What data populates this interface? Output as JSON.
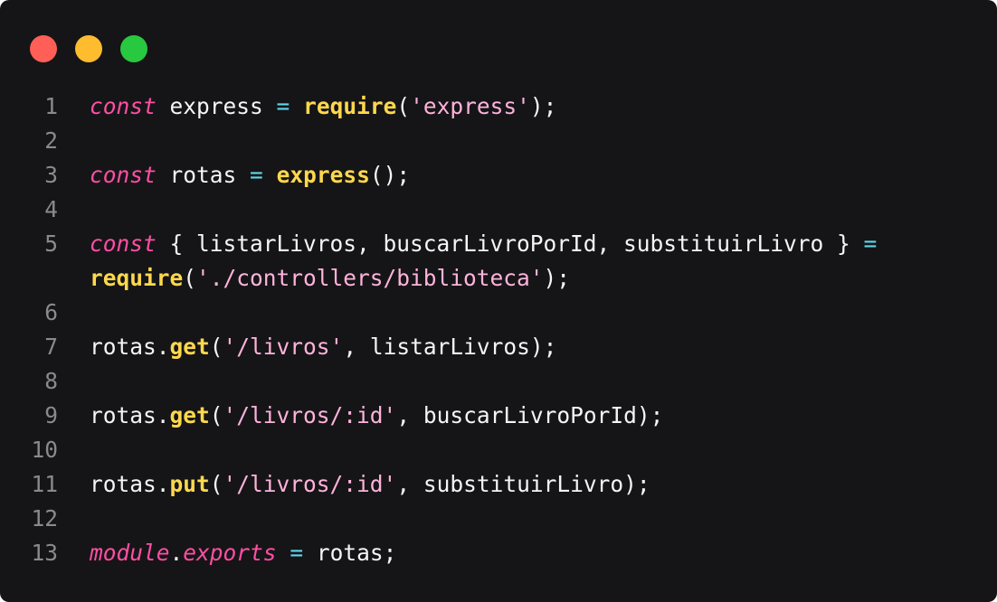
{
  "window": {
    "controls": [
      {
        "name": "close",
        "color": "#ff5f57"
      },
      {
        "name": "minimize",
        "color": "#febc2e"
      },
      {
        "name": "maximize",
        "color": "#28c840"
      }
    ]
  },
  "theme": {
    "background": "#151517",
    "keyword": "#ff4fa3",
    "function": "#ffd84d",
    "string": "#ffb3dc",
    "operator": "#5fd6ea",
    "text": "#f5f5f5",
    "line_number": "#8a8a8a"
  },
  "code": {
    "lines": [
      {
        "n": "1",
        "tokens": [
          {
            "t": "const",
            "c": "kw"
          },
          {
            "t": " express ",
            "c": "plain"
          },
          {
            "t": "=",
            "c": "op"
          },
          {
            "t": " ",
            "c": "plain"
          },
          {
            "t": "require",
            "c": "fn"
          },
          {
            "t": "(",
            "c": "plain"
          },
          {
            "t": "'express'",
            "c": "str"
          },
          {
            "t": ");",
            "c": "plain"
          }
        ]
      },
      {
        "n": "2",
        "tokens": []
      },
      {
        "n": "3",
        "tokens": [
          {
            "t": "const",
            "c": "kw"
          },
          {
            "t": " rotas ",
            "c": "plain"
          },
          {
            "t": "=",
            "c": "op"
          },
          {
            "t": " ",
            "c": "plain"
          },
          {
            "t": "express",
            "c": "fn"
          },
          {
            "t": "();",
            "c": "plain"
          }
        ]
      },
      {
        "n": "4",
        "tokens": []
      },
      {
        "n": "5",
        "tokens": [
          {
            "t": "const",
            "c": "kw"
          },
          {
            "t": " { listarLivros, buscarLivroPorId, substituirLivro } ",
            "c": "plain"
          },
          {
            "t": "=",
            "c": "op"
          }
        ]
      },
      {
        "n": "",
        "tokens": [
          {
            "t": "require",
            "c": "fn"
          },
          {
            "t": "(",
            "c": "plain"
          },
          {
            "t": "'./controllers/biblioteca'",
            "c": "str"
          },
          {
            "t": ");",
            "c": "plain"
          }
        ]
      },
      {
        "n": "6",
        "tokens": []
      },
      {
        "n": "7",
        "tokens": [
          {
            "t": "rotas.",
            "c": "plain"
          },
          {
            "t": "get",
            "c": "fn"
          },
          {
            "t": "(",
            "c": "plain"
          },
          {
            "t": "'/livros'",
            "c": "str"
          },
          {
            "t": ", listarLivros);",
            "c": "plain"
          }
        ]
      },
      {
        "n": "8",
        "tokens": []
      },
      {
        "n": "9",
        "tokens": [
          {
            "t": "rotas.",
            "c": "plain"
          },
          {
            "t": "get",
            "c": "fn"
          },
          {
            "t": "(",
            "c": "plain"
          },
          {
            "t": "'/livros/:id'",
            "c": "str"
          },
          {
            "t": ", buscarLivroPorId);",
            "c": "plain"
          }
        ]
      },
      {
        "n": "10",
        "tokens": []
      },
      {
        "n": "11",
        "tokens": [
          {
            "t": "rotas.",
            "c": "plain"
          },
          {
            "t": "put",
            "c": "fn"
          },
          {
            "t": "(",
            "c": "plain"
          },
          {
            "t": "'/livros/:id'",
            "c": "str"
          },
          {
            "t": ", substituirLivro);",
            "c": "plain"
          }
        ]
      },
      {
        "n": "12",
        "tokens": []
      },
      {
        "n": "13",
        "tokens": [
          {
            "t": "module",
            "c": "kw"
          },
          {
            "t": ".",
            "c": "plain"
          },
          {
            "t": "exports",
            "c": "kw"
          },
          {
            "t": " ",
            "c": "plain"
          },
          {
            "t": "=",
            "c": "op"
          },
          {
            "t": " rotas;",
            "c": "plain"
          }
        ]
      }
    ]
  }
}
